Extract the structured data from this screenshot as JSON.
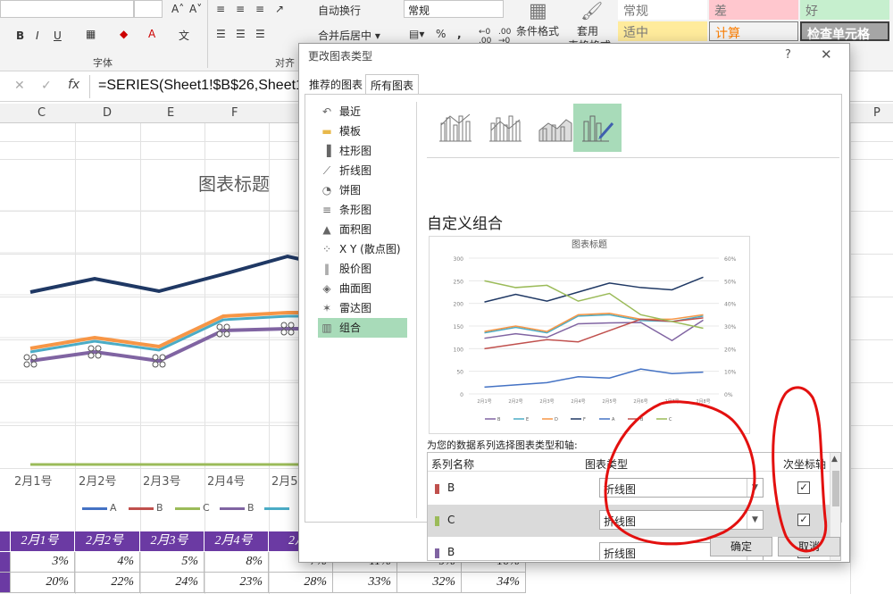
{
  "ribbon": {
    "font_group_label": "字体",
    "align_group_label": "对齐",
    "wrap_text": "自动换行",
    "merge_center": "合并后居中",
    "number_format": "常规",
    "percent": "%",
    "comma": ",",
    "conditional_format": "条件格式",
    "format_as_table": "套用",
    "format_as_table2": "表格格式",
    "styles": {
      "normal": "常规",
      "bad": "差",
      "good": "好",
      "neutral": "适中",
      "calc": "计算",
      "check_cell": "检查单元格"
    },
    "bold": "B",
    "italic": "I",
    "underline": "U",
    "font_color": "A"
  },
  "formula_bar": {
    "cancel": "✕",
    "confirm": "✓",
    "fx": "fx",
    "formula": "=SERIES(Sheet1!$B$26,Sheet1"
  },
  "columns": [
    "C",
    "D",
    "E",
    "F",
    "P"
  ],
  "chart": {
    "title": "图表标题",
    "categories": [
      "2月1号",
      "2月2号",
      "2月3号",
      "2月4号",
      "2月5"
    ],
    "legend": [
      {
        "label": "A",
        "color": "#4472c4"
      },
      {
        "label": "B",
        "color": "#c0504d"
      },
      {
        "label": "C",
        "color": "#9bbb59"
      },
      {
        "label": "B",
        "color": "#8064a2"
      },
      {
        "label": "",
        "color": "#4bacc6"
      }
    ]
  },
  "table": {
    "header": [
      "2月1号",
      "2月2号",
      "2月3号",
      "2月4号",
      "2月",
      "",
      "",
      ""
    ],
    "rows": [
      [
        "3%",
        "4%",
        "5%",
        "8%",
        "7%",
        "11%",
        "9%",
        "10%"
      ],
      [
        "20%",
        "22%",
        "24%",
        "23%",
        "28%",
        "33%",
        "32%",
        "34%"
      ]
    ]
  },
  "dialog": {
    "title": "更改图表类型",
    "help": "?",
    "close": "✕",
    "tabs": {
      "recommended": "推荐的图表",
      "all": "所有图表"
    },
    "sidebar": [
      {
        "label": "最近",
        "icon": "↶"
      },
      {
        "label": "模板",
        "icon": "▬"
      },
      {
        "label": "柱形图",
        "icon": "▐"
      },
      {
        "label": "折线图",
        "icon": "⟋"
      },
      {
        "label": "饼图",
        "icon": "◔"
      },
      {
        "label": "条形图",
        "icon": "≡"
      },
      {
        "label": "面积图",
        "icon": "▲"
      },
      {
        "label": "X Y (散点图)",
        "icon": "⁘"
      },
      {
        "label": "股价图",
        "icon": "‖"
      },
      {
        "label": "曲面图",
        "icon": "◈"
      },
      {
        "label": "雷达图",
        "icon": "✶"
      },
      {
        "label": "组合",
        "icon": "▥"
      }
    ],
    "combo_title": "自定义组合",
    "preview_title": "图表标题",
    "series_caption": "为您的数据系列选择图表类型和轴:",
    "series_headers": {
      "name": "系列名称",
      "type": "图表类型",
      "axis": "次坐标轴"
    },
    "series": [
      {
        "name": "B",
        "color": "#c0504d",
        "type": "折线图",
        "secondary": true
      },
      {
        "name": "C",
        "color": "#9bbb59",
        "type": "折线图",
        "secondary": true
      },
      {
        "name": "B",
        "color": "#8064a2",
        "type": "折线图",
        "secondary": false
      }
    ],
    "ok": "确定",
    "cancel": "取消"
  },
  "chart_data": {
    "type": "line",
    "title": "图表标题",
    "categories": [
      "2月1号",
      "2月2号",
      "2月3号",
      "2月4号",
      "2月5号",
      "2月6号",
      "2月7号",
      "2月8号"
    ],
    "yleft": [
      0,
      300
    ],
    "yright_ticks": [
      "0%",
      "10%",
      "20%",
      "30%",
      "40%",
      "50%",
      "60%"
    ],
    "yleft_ticks": [
      "0",
      "50",
      "100",
      "150",
      "200",
      "250",
      "300"
    ],
    "series": [
      {
        "name": "B",
        "color": "#8064a2",
        "values": [
          123,
          133,
          125,
          155,
          157,
          158,
          118,
          163
        ]
      },
      {
        "name": "E",
        "color": "#4bacc6",
        "values": [
          135,
          147,
          135,
          172,
          175,
          162,
          160,
          172
        ]
      },
      {
        "name": "D",
        "color": "#f79646",
        "values": [
          138,
          150,
          138,
          175,
          178,
          165,
          165,
          175
        ]
      },
      {
        "name": "F",
        "color": "#1f3864",
        "values": [
          203,
          220,
          205,
          225,
          245,
          235,
          230,
          258
        ]
      },
      {
        "name": "A",
        "color": "#4472c4",
        "values": [
          15,
          20,
          25,
          38,
          35,
          55,
          45,
          48
        ]
      },
      {
        "name": "B",
        "color": "#c0504d",
        "values": [
          100,
          110,
          120,
          115,
          140,
          165,
          160,
          168
        ]
      },
      {
        "name": "C",
        "color": "#9bbb59",
        "values": [
          250,
          235,
          240,
          205,
          222,
          175,
          160,
          145
        ]
      }
    ]
  }
}
